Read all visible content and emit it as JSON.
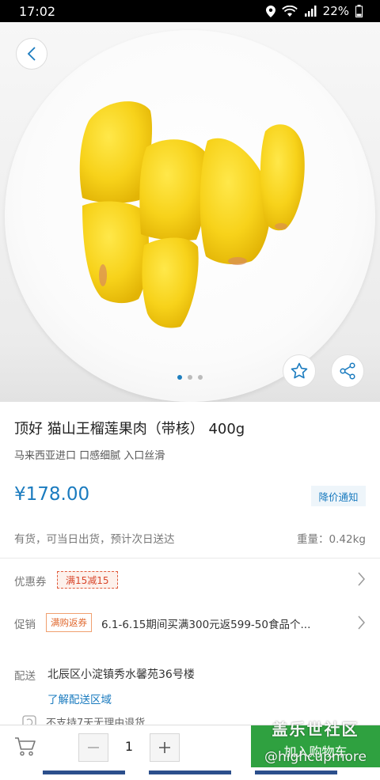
{
  "status_bar": {
    "time": "17:02",
    "battery": "22%"
  },
  "hero": {
    "carousel_total": 3,
    "carousel_active": 1
  },
  "product": {
    "title": "顶好 猫山王榴莲果肉（带核） 400g",
    "subtitle": "马来西亚进口 口感细腻 入口丝滑",
    "price": "¥178.00",
    "price_alert_label": "降价通知",
    "stock_status": "有货，可当日出货，预计次日送达",
    "weight": "重量：0.42kg"
  },
  "coupon": {
    "label": "优惠券",
    "tag": "满15减15"
  },
  "promotion": {
    "label": "促销",
    "tag": "满购返券",
    "text": "6.1-6.15期间买满300元返599-50食品个..."
  },
  "delivery": {
    "label": "配送",
    "address": "北辰区小淀镇秀水馨苑36号楼",
    "area_link": "了解配送区域",
    "return_policy": "不支持7天无理由退货"
  },
  "bottom_bar": {
    "quantity": "1",
    "add_to_cart_label": "加入购物车"
  },
  "watermark": {
    "line1": "盖乐世社区",
    "line2": "@highcupmore"
  },
  "colors": {
    "accent_blue": "#1a7bbf",
    "cart_green": "#2fa140",
    "coupon_red": "#d8452a"
  },
  "icons": [
    "back-chevron-icon",
    "star-icon",
    "share-icon",
    "cart-icon",
    "minus-icon",
    "plus-icon",
    "chevron-right-icon",
    "return-policy-icon",
    "location-icon",
    "wifi-icon",
    "signal-icon",
    "battery-icon"
  ]
}
